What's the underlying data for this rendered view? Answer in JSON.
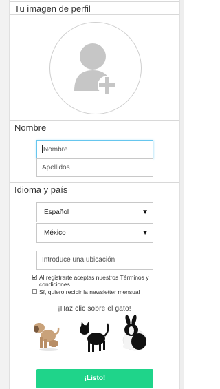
{
  "profile": {
    "title": "Tu imagen de perfil"
  },
  "name_section": {
    "title": "Nombre",
    "first_name": {
      "value": "",
      "placeholder": "Nombre"
    },
    "last_name": {
      "value": "",
      "placeholder": "Apellidos"
    }
  },
  "locale_section": {
    "title": "Idioma y país",
    "language": "Español",
    "country": "México",
    "location": {
      "value": "",
      "placeholder": "Introduce una ubicación"
    }
  },
  "terms": {
    "accept_label": "Al registrarte aceptas nuestros Términos y condiciones",
    "accept_checked": true,
    "newsletter_label": "Sí, quiero recibir la newsletter mensual",
    "newsletter_checked": false
  },
  "pets": {
    "prompt": "¡Haz clic sobre el gato!",
    "items": [
      "dog",
      "cat",
      "rabbit"
    ]
  },
  "submit": {
    "label": "¡Listo!"
  },
  "colors": {
    "accent": "#1fd48a",
    "focus": "#66c6ee"
  }
}
